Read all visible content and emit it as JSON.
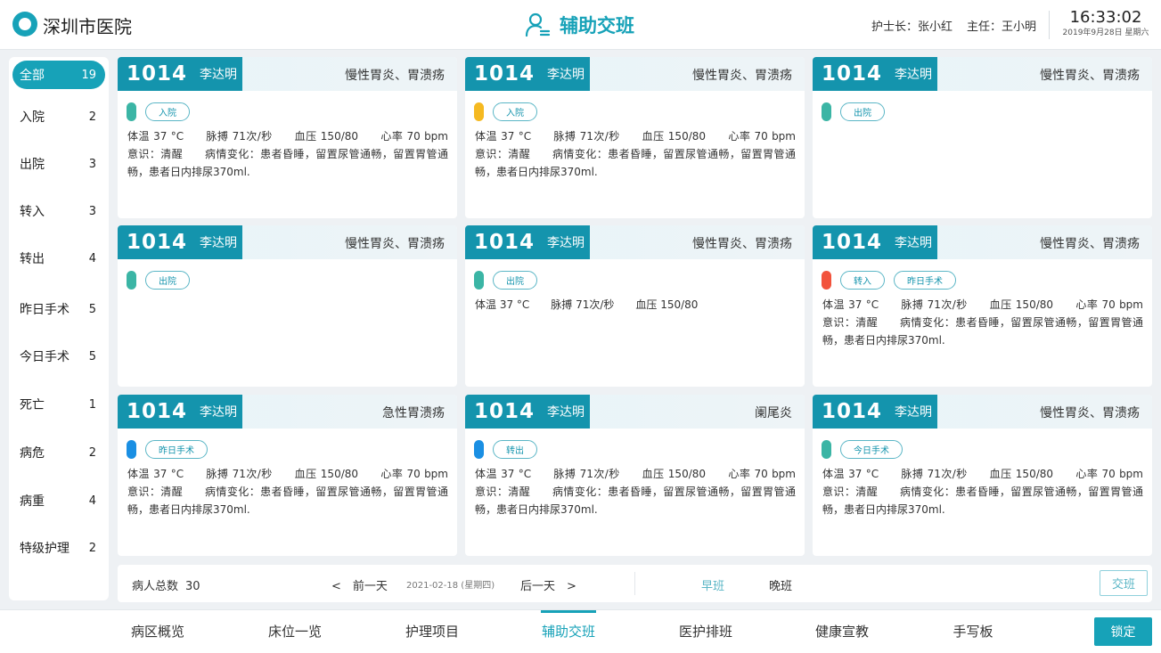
{
  "header": {
    "hospital_name": "深圳市医院",
    "page_title": "辅助交班",
    "head_nurse": "护士长：张小红",
    "director": "主任：王小明",
    "time": "16:33:02",
    "date": "2019年9月28日 星期六"
  },
  "sidebar": {
    "items": [
      {
        "label": "全部",
        "count": "19"
      },
      {
        "label": "入院",
        "count": "2"
      },
      {
        "label": "出院",
        "count": "3"
      },
      {
        "label": "转入",
        "count": "3"
      },
      {
        "label": "转出",
        "count": "4"
      },
      {
        "label": "昨日手术",
        "count": "5"
      },
      {
        "label": "今日手术",
        "count": "5"
      },
      {
        "label": "死亡",
        "count": "1"
      },
      {
        "label": "病危",
        "count": "2"
      },
      {
        "label": "病重",
        "count": "4"
      },
      {
        "label": "特级护理",
        "count": "2"
      }
    ]
  },
  "colors": {
    "accent": "#17a2b8",
    "status_teal": "#3bb5a5",
    "status_yellow": "#f5b921",
    "status_red": "#f2533c",
    "status_blue": "#1a8fe3"
  },
  "cards": [
    {
      "bed": "1014",
      "name": "李达明",
      "diagnosis": "慢性胃炎、胃溃疡",
      "status_color": "#3bb5a5",
      "tags": [
        "入院"
      ],
      "body": "体温 37 °C　　脉搏 71次/秒　　血压 150/80　　心率 70 bpm　意识：清醒　　病情变化：患者昏睡，留置尿管通畅，留置胃管通畅，患者日内排尿370ml."
    },
    {
      "bed": "1014",
      "name": "李达明",
      "diagnosis": "慢性胃炎、胃溃疡",
      "status_color": "#f5b921",
      "tags": [
        "入院"
      ],
      "body": "体温 37 °C　　脉搏 71次/秒　　血压 150/80　　心率 70 bpm　意识：清醒　　病情变化：患者昏睡，留置尿管通畅，留置胃管通畅，患者日内排尿370ml."
    },
    {
      "bed": "1014",
      "name": "李达明",
      "diagnosis": "慢性胃炎、胃溃疡",
      "status_color": "#3bb5a5",
      "tags": [
        "出院"
      ],
      "body": ""
    },
    {
      "bed": "1014",
      "name": "李达明",
      "diagnosis": "慢性胃炎、胃溃疡",
      "status_color": "#3bb5a5",
      "tags": [
        "出院"
      ],
      "body": ""
    },
    {
      "bed": "1014",
      "name": "李达明",
      "diagnosis": "慢性胃炎、胃溃疡",
      "status_color": "#3bb5a5",
      "tags": [
        "出院"
      ],
      "body": "体温 37 °C　　脉搏 71次/秒　　血压 150/80"
    },
    {
      "bed": "1014",
      "name": "李达明",
      "diagnosis": "慢性胃炎、胃溃疡",
      "status_color": "#f2533c",
      "tags": [
        "转入",
        "昨日手术"
      ],
      "body": "体温 37 °C　　脉搏 71次/秒　　血压 150/80　　心率 70 bpm　意识：清醒　　病情变化：患者昏睡，留置尿管通畅，留置胃管通畅，患者日内排尿370ml."
    },
    {
      "bed": "1014",
      "name": "李达明",
      "diagnosis": "急性胃溃疡",
      "status_color": "#1a8fe3",
      "tags": [
        "昨日手术"
      ],
      "body": "体温 37 °C　　脉搏 71次/秒　　血压 150/80　　心率 70 bpm　意识：清醒　　病情变化：患者昏睡，留置尿管通畅，留置胃管通畅，患者日内排尿370ml."
    },
    {
      "bed": "1014",
      "name": "李达明",
      "diagnosis": "阑尾炎",
      "status_color": "#1a8fe3",
      "tags": [
        "转出"
      ],
      "body": "体温 37 °C　　脉搏 71次/秒　　血压 150/80　　心率 70 bpm　意识：清醒　　病情变化：患者昏睡，留置尿管通畅，留置胃管通畅，患者日内排尿370ml."
    },
    {
      "bed": "1014",
      "name": "李达明",
      "diagnosis": "慢性胃炎、胃溃疡",
      "status_color": "#3bb5a5",
      "tags": [
        "今日手术"
      ],
      "body": "体温 37 °C　　脉搏 71次/秒　　血压 150/80　　心率 70 bpm　意识：清醒　　病情变化：患者昏睡，留置尿管通畅，留置胃管通畅，患者日内排尿370ml."
    }
  ],
  "bottom_bar": {
    "total_label": "病人总数",
    "total_count": "30",
    "prev_day": "<　前一天",
    "current_date": "2021-02-18 (星期四)",
    "next_day": "后一天　>",
    "shift_early": "早班",
    "shift_late": "晚班",
    "handover_button": "交班"
  },
  "nav": {
    "items": [
      "病区概览",
      "床位一览",
      "护理项目",
      "辅助交班",
      "医护排班",
      "健康宣教",
      "手写板"
    ],
    "active_index": 3,
    "lock_button": "锁定"
  }
}
